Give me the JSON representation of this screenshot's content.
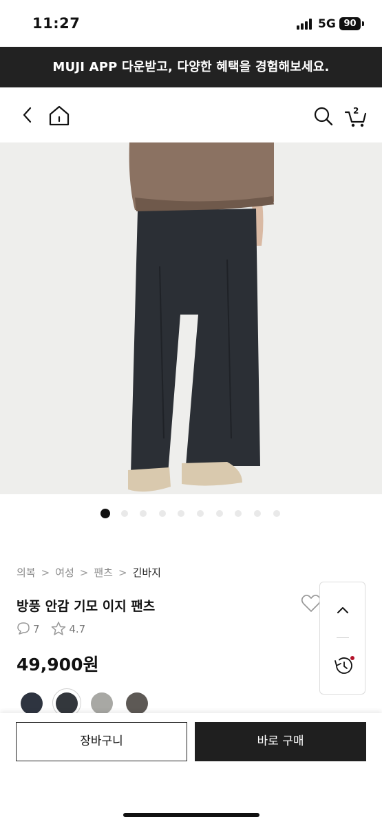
{
  "status_bar": {
    "time": "11:27",
    "network": "5G",
    "battery": "90"
  },
  "app_banner": {
    "text": "MUJI APP 다운받고, 다양한 혜택을 경험해보세요."
  },
  "header": {
    "cart_count": "2",
    "icons": [
      "back-icon",
      "home-icon",
      "search-icon",
      "cart-icon"
    ]
  },
  "gallery": {
    "image_description_icon": "product-photo",
    "total_slides": 10,
    "active_slide": 1
  },
  "breadcrumb": {
    "items": [
      "의복",
      "여성",
      "팬츠",
      "긴바지"
    ],
    "separator": ">"
  },
  "product": {
    "title": "방풍 안감 기모 이지 팬츠",
    "review_count": "7",
    "rating": "4.7",
    "price": "49,900원"
  },
  "colors": {
    "swatches": [
      "#2e3440",
      "#33373c",
      "#a8a8a4",
      "#5d5955"
    ],
    "selected_index": 1
  },
  "actions": {
    "cart_label": "장바구니",
    "buy_label": "바로 구매"
  }
}
